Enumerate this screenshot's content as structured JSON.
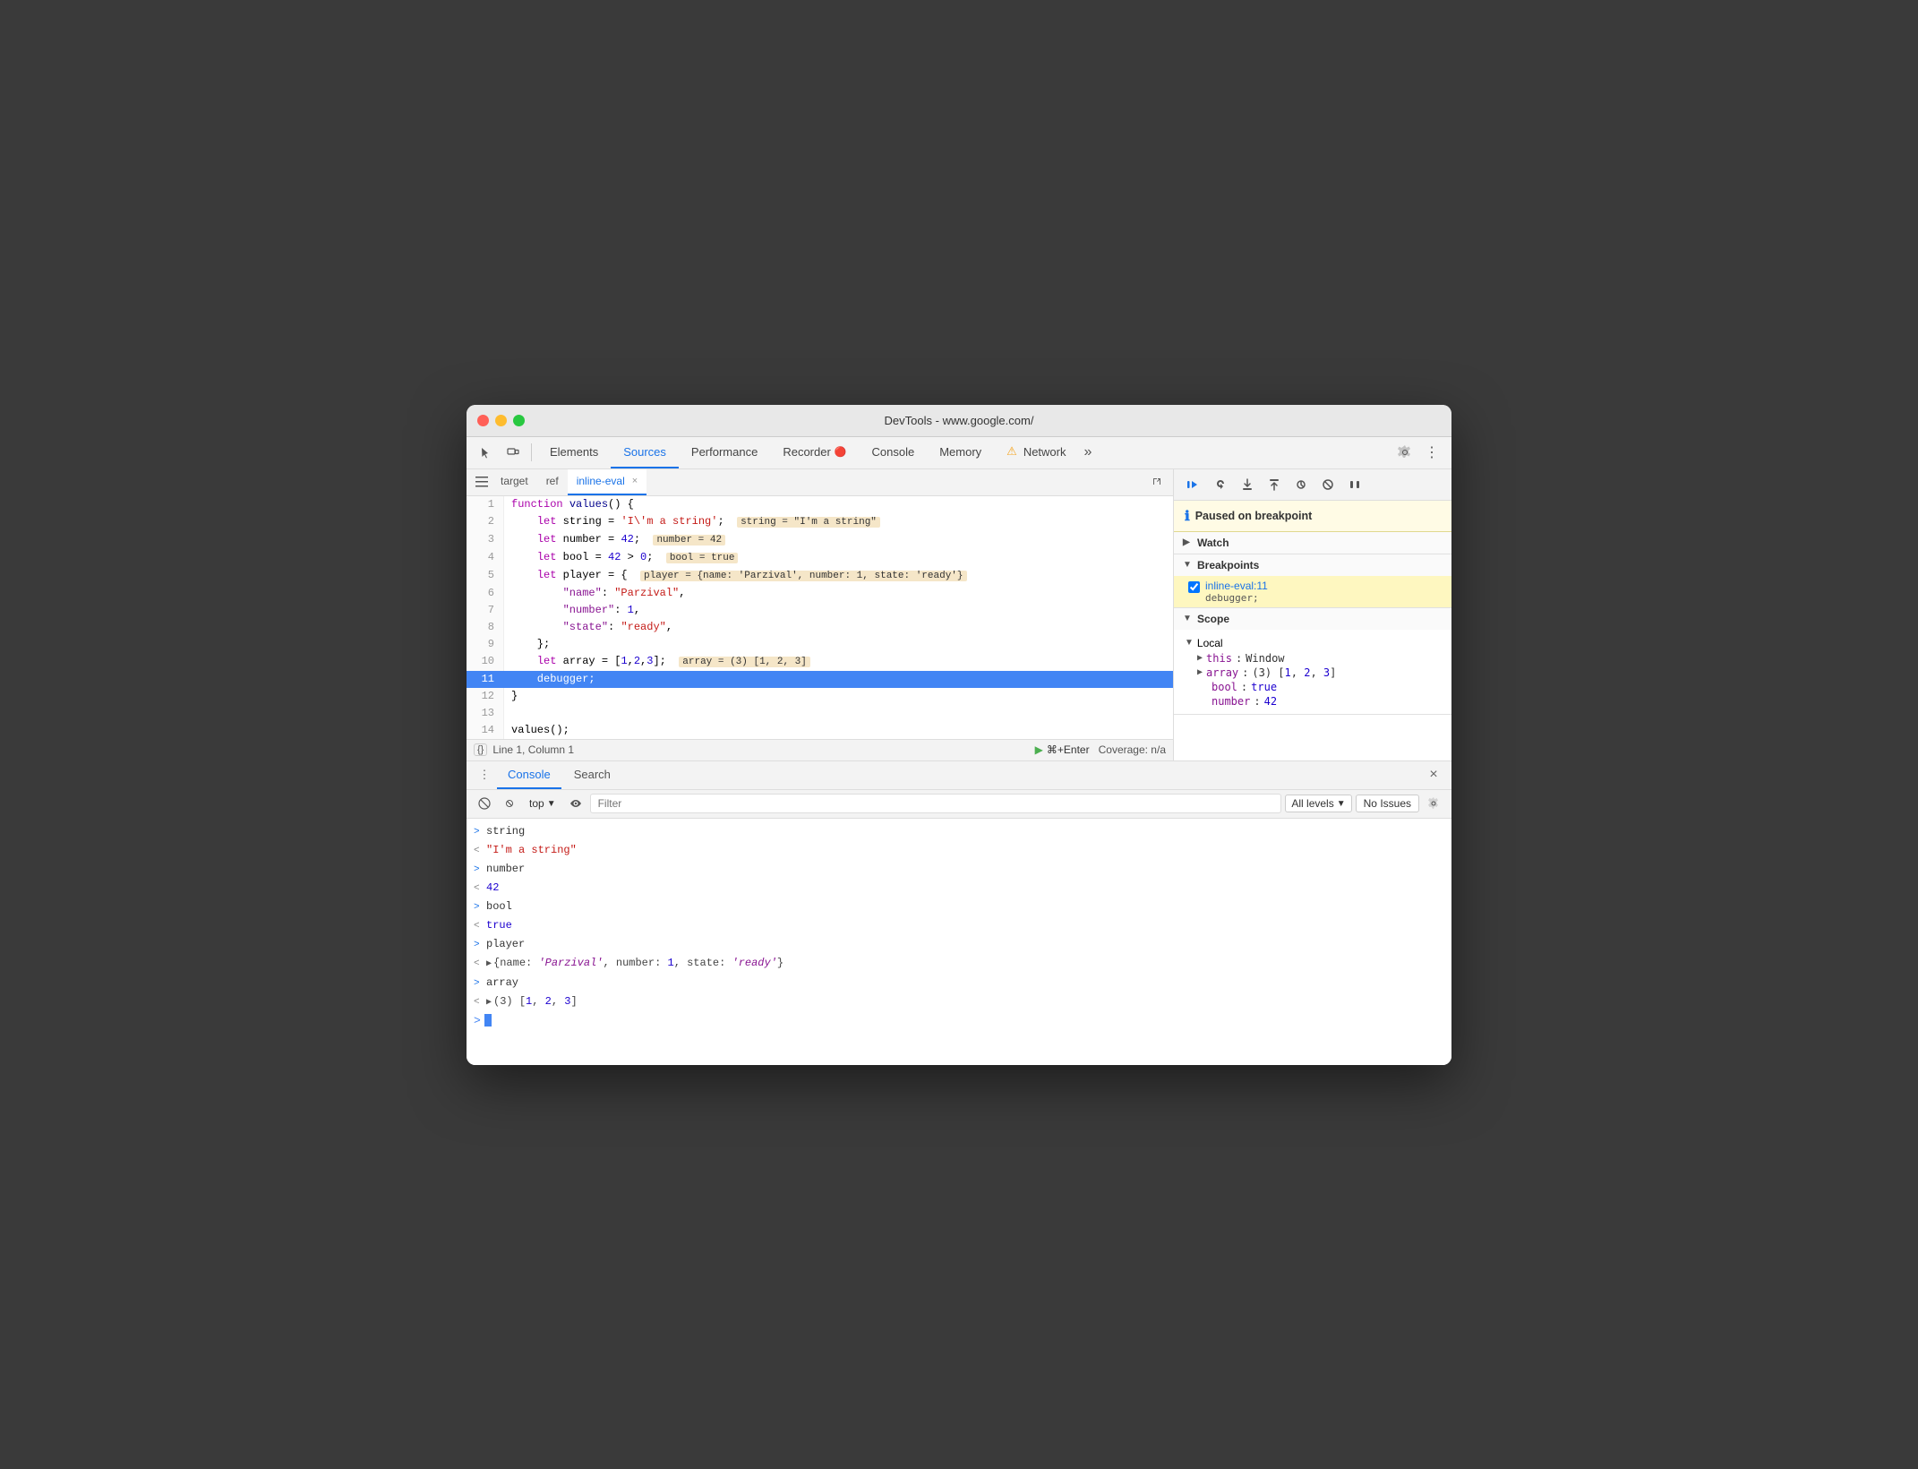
{
  "window": {
    "title": "DevTools - www.google.com/"
  },
  "toolbar": {
    "tabs": [
      {
        "id": "elements",
        "label": "Elements",
        "active": false
      },
      {
        "id": "sources",
        "label": "Sources",
        "active": true
      },
      {
        "id": "performance",
        "label": "Performance",
        "active": false
      },
      {
        "id": "recorder",
        "label": "Recorder",
        "active": false
      },
      {
        "id": "console",
        "label": "Console",
        "active": false
      },
      {
        "id": "memory",
        "label": "Memory",
        "active": false
      },
      {
        "id": "network",
        "label": "Network",
        "active": false
      }
    ],
    "more_label": "»",
    "settings_title": "Settings",
    "more_tools_title": "More tools"
  },
  "file_tabs": [
    {
      "id": "target",
      "label": "target",
      "active": false,
      "closeable": false
    },
    {
      "id": "ref",
      "label": "ref",
      "active": false,
      "closeable": false
    },
    {
      "id": "inline-eval",
      "label": "inline-eval",
      "active": true,
      "closeable": true
    }
  ],
  "code": {
    "lines": [
      {
        "num": 1,
        "content": "function values() {",
        "active": false
      },
      {
        "num": 2,
        "content": "    let string = 'I\\'m a string';",
        "active": false,
        "inline_val": "string = \"I'm a string\""
      },
      {
        "num": 3,
        "content": "    let number = 42;",
        "active": false,
        "inline_val": "number = 42"
      },
      {
        "num": 4,
        "content": "    let bool = 42 > 0;",
        "active": false,
        "inline_val": "bool = true"
      },
      {
        "num": 5,
        "content": "    let player = {",
        "active": false,
        "inline_val": "player = {name: 'Parzival', number: 1, state: 'ready'}"
      },
      {
        "num": 6,
        "content": "        \"name\": \"Parzival\",",
        "active": false
      },
      {
        "num": 7,
        "content": "        \"number\": 1,",
        "active": false
      },
      {
        "num": 8,
        "content": "        \"state\": \"ready\",",
        "active": false
      },
      {
        "num": 9,
        "content": "    };",
        "active": false
      },
      {
        "num": 10,
        "content": "    let array = [1,2,3];",
        "active": false,
        "inline_val": "array = (3) [1, 2, 3]"
      },
      {
        "num": 11,
        "content": "    debugger;",
        "active": true
      },
      {
        "num": 12,
        "content": "}",
        "active": false
      },
      {
        "num": 13,
        "content": "",
        "active": false
      },
      {
        "num": 14,
        "content": "values();",
        "active": false
      }
    ]
  },
  "status_bar": {
    "braces_label": "{}",
    "position": "Line 1, Column 1",
    "run_label": "⌘+Enter",
    "coverage": "Coverage: n/a"
  },
  "debugger": {
    "paused_message": "Paused on breakpoint",
    "watch_label": "Watch",
    "breakpoints_label": "Breakpoints",
    "breakpoint": {
      "file": "inline-eval:11",
      "code": "debugger;"
    },
    "scope_label": "Scope",
    "local_label": "Local",
    "scope_items": [
      {
        "key": "this",
        "value": "Window",
        "type": "obj"
      },
      {
        "key": "array",
        "value": "(3) [1, 2, 3]",
        "type": "obj",
        "expandable": true
      },
      {
        "key": "bool",
        "value": "true",
        "type": "bool"
      },
      {
        "key": "number",
        "value": "42",
        "type": "num"
      }
    ]
  },
  "bottom": {
    "tabs": [
      {
        "id": "console",
        "label": "Console",
        "active": true
      },
      {
        "id": "search",
        "label": "Search",
        "active": false
      }
    ],
    "console_filter": {
      "placeholder": "Filter",
      "level": "All levels",
      "issues": "No Issues"
    },
    "context_label": "top",
    "entries": [
      {
        "direction": "out",
        "text": "string",
        "type": "key"
      },
      {
        "direction": "in",
        "text": "\"I'm a string\"",
        "type": "str"
      },
      {
        "direction": "out",
        "text": "number",
        "type": "key"
      },
      {
        "direction": "in",
        "text": "42",
        "type": "num"
      },
      {
        "direction": "out",
        "text": "bool",
        "type": "key"
      },
      {
        "direction": "in",
        "text": "true",
        "type": "bool"
      },
      {
        "direction": "out",
        "text": "player",
        "type": "key"
      },
      {
        "direction": "in",
        "text": "{name: 'Parzival', number: 1, state: 'ready'}",
        "type": "obj",
        "expandable": true
      },
      {
        "direction": "out",
        "text": "array",
        "type": "key"
      },
      {
        "direction": "in",
        "text": "(3) [1, 2, 3]",
        "type": "obj",
        "expandable": true
      }
    ]
  }
}
